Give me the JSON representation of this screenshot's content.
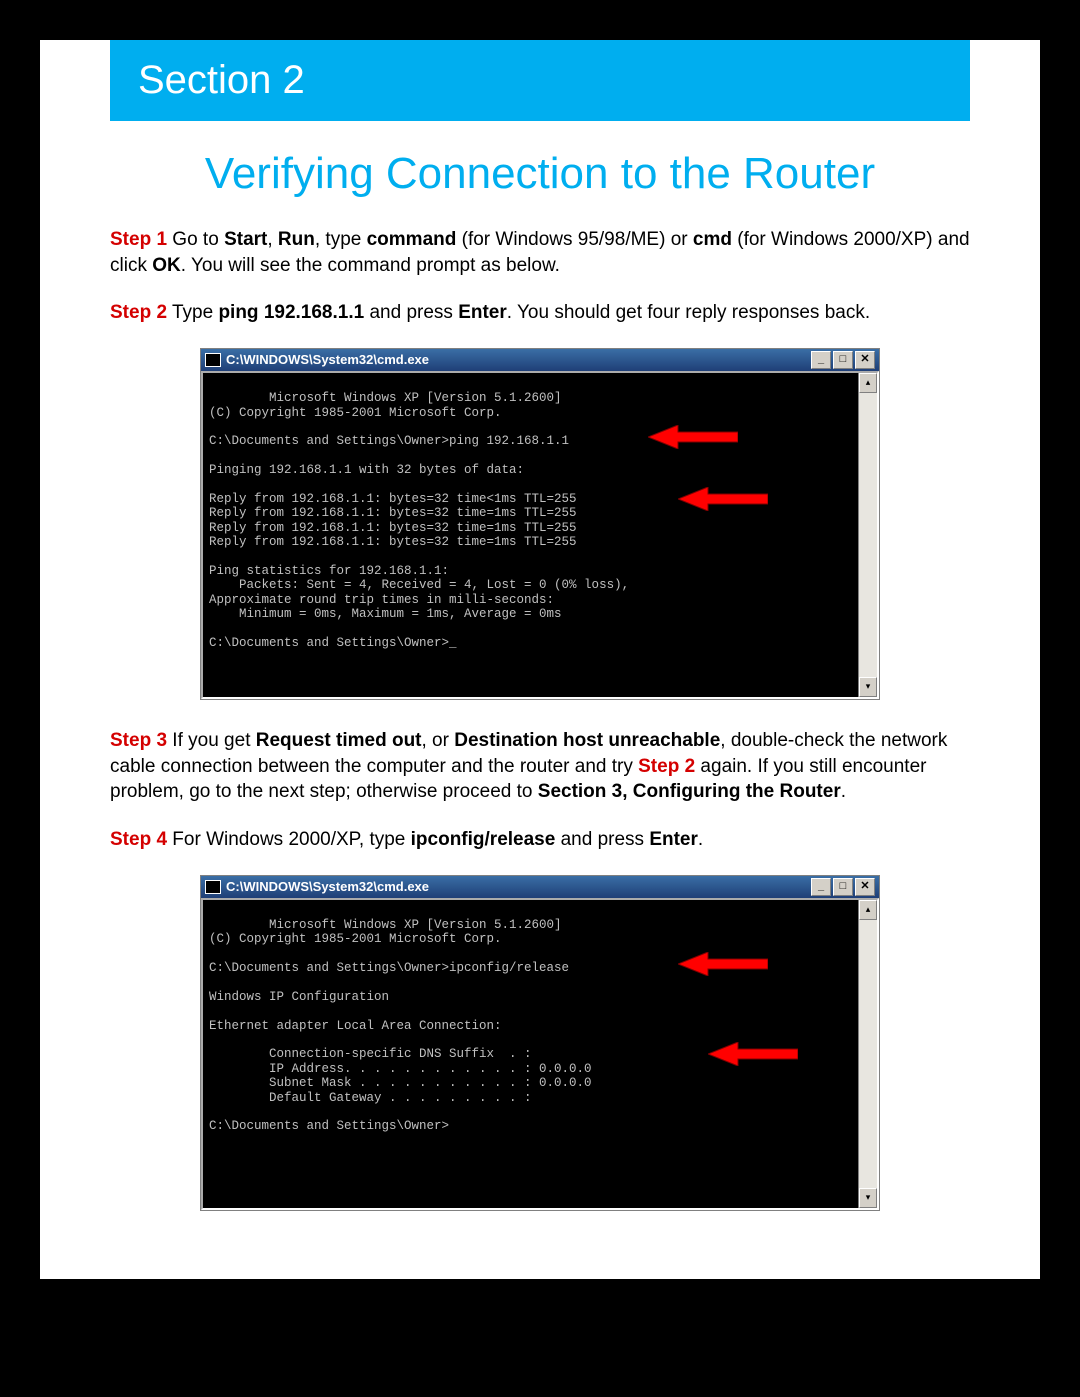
{
  "section_banner": "Section 2",
  "page_title": "Verifying Connection to the Router",
  "steps": {
    "s1": {
      "label": "Step 1",
      "t1": " Go to ",
      "b1": "Start",
      "t2": ", ",
      "b2": "Run",
      "t3": ", type ",
      "b3": "command",
      "t4": " (for Windows 95/98/ME) or ",
      "b4": "cmd",
      "t5": " (for Windows 2000/XP) and click ",
      "b5": "OK",
      "t6": ". You will see the command prompt as below."
    },
    "s2": {
      "label": "Step 2",
      "t1": " Type ",
      "b1": "ping 192.168.1.1",
      "t2": " and press ",
      "b2": "Enter",
      "t3": ". You should get four reply responses back."
    },
    "s3": {
      "label": "Step 3",
      "t1": " If you get ",
      "b1": "Request timed out",
      "t2": ", or ",
      "b2": "Destination host unreachable",
      "t3": ", double-check the network cable connection between the computer and the router and try ",
      "rlabel": "Step 2",
      "t4": " again. If you still encounter problem, go to the next step; otherwise proceed to ",
      "b3": "Section 3, Configuring the Router",
      "t5": "."
    },
    "s4": {
      "label": "Step 4",
      "t1": " For Windows 2000/XP, type ",
      "b1": "ipconfig/release",
      "t2": " and press ",
      "b2": "Enter",
      "t3": "."
    }
  },
  "cmd1": {
    "title": "C:\\WINDOWS\\System32\\cmd.exe",
    "min": "_",
    "max": "□",
    "close": "✕",
    "up": "▴",
    "down": "▾",
    "text": "Microsoft Windows XP [Version 5.1.2600]\n(C) Copyright 1985-2001 Microsoft Corp.\n\nC:\\Documents and Settings\\Owner>ping 192.168.1.1\n\nPinging 192.168.1.1 with 32 bytes of data:\n\nReply from 192.168.1.1: bytes=32 time<1ms TTL=255\nReply from 192.168.1.1: bytes=32 time=1ms TTL=255\nReply from 192.168.1.1: bytes=32 time=1ms TTL=255\nReply from 192.168.1.1: bytes=32 time=1ms TTL=255\n\nPing statistics for 192.168.1.1:\n    Packets: Sent = 4, Received = 4, Lost = 0 (0% loss),\nApproximate round trip times in milli-seconds:\n    Minimum = 0ms, Maximum = 1ms, Average = 0ms\n\nC:\\Documents and Settings\\Owner>_"
  },
  "cmd2": {
    "title": "C:\\WINDOWS\\System32\\cmd.exe",
    "min": "_",
    "max": "□",
    "close": "✕",
    "up": "▴",
    "down": "▾",
    "text": "Microsoft Windows XP [Version 5.1.2600]\n(C) Copyright 1985-2001 Microsoft Corp.\n\nC:\\Documents and Settings\\Owner>ipconfig/release\n\nWindows IP Configuration\n\nEthernet adapter Local Area Connection:\n\n        Connection-specific DNS Suffix  . :\n        IP Address. . . . . . . . . . . . : 0.0.0.0\n        Subnet Mask . . . . . . . . . . . : 0.0.0.0\n        Default Gateway . . . . . . . . . :\n\nC:\\Documents and Settings\\Owner>"
  }
}
